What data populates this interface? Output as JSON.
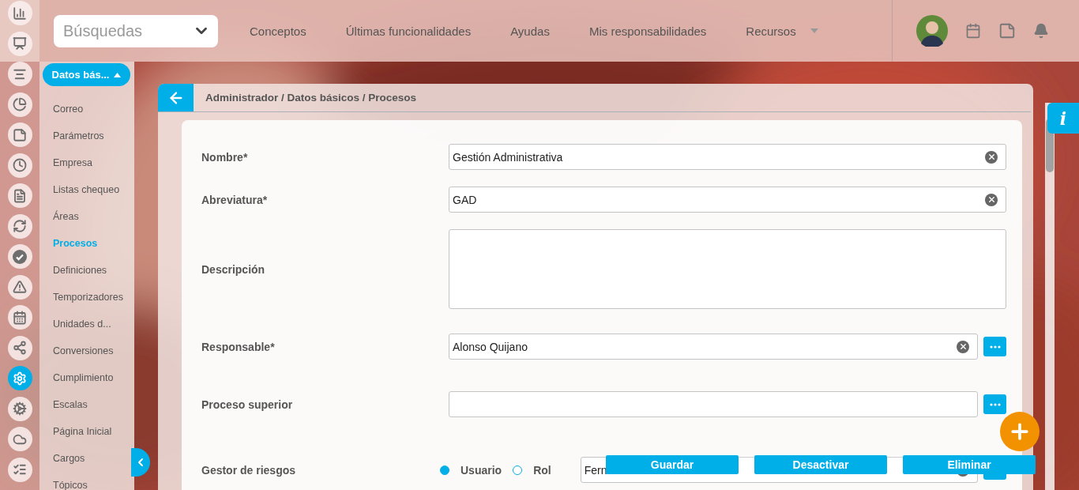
{
  "search": {
    "placeholder": "Búsquedas"
  },
  "nav": [
    {
      "label": "Conceptos"
    },
    {
      "label": "Últimas funcionalidades"
    },
    {
      "label": "Ayudas"
    },
    {
      "label": "Mis responsabilidades"
    },
    {
      "label": "Recursos",
      "dropdown": true
    }
  ],
  "rail": [
    {
      "selected": false
    },
    {
      "selected": false
    },
    {
      "selected": false
    },
    {
      "selected": false
    },
    {
      "selected": false
    },
    {
      "selected": false
    },
    {
      "selected": false
    },
    {
      "selected": false
    },
    {
      "selected": false
    },
    {
      "selected": false
    },
    {
      "selected": false
    },
    {
      "selected": false
    },
    {
      "selected": true
    },
    {
      "selected": false
    },
    {
      "selected": false
    },
    {
      "selected": false
    }
  ],
  "sidebar": {
    "section": "Datos bás...",
    "items": [
      {
        "label": "Correo",
        "selected": false
      },
      {
        "label": "Parámetros",
        "selected": false
      },
      {
        "label": "Empresa",
        "selected": false
      },
      {
        "label": "Listas chequeo",
        "selected": false
      },
      {
        "label": "Áreas",
        "selected": false
      },
      {
        "label": "Procesos",
        "selected": true
      },
      {
        "label": "Definiciones",
        "selected": false
      },
      {
        "label": "Temporizadores",
        "selected": false
      },
      {
        "label": "Unidades d...",
        "selected": false
      },
      {
        "label": "Conversiones",
        "selected": false
      },
      {
        "label": "Cumplimiento",
        "selected": false
      },
      {
        "label": "Escalas",
        "selected": false
      },
      {
        "label": "Página Inicial",
        "selected": false
      },
      {
        "label": "Cargos",
        "selected": false
      },
      {
        "label": "Tópicos",
        "selected": false
      }
    ]
  },
  "breadcrumb": "Administrador / Datos básicos / Procesos",
  "form": [
    {
      "kind": "text",
      "label": "Nombre*",
      "value": "Gestión Administrativa"
    },
    {
      "kind": "text",
      "label": "Abreviatura*",
      "value": "GAD"
    },
    {
      "kind": "textarea",
      "label": "Descripción"
    },
    {
      "kind": "lookup",
      "label": "Responsable*",
      "value": "Alonso Quijano"
    },
    {
      "kind": "lookup",
      "label": "Proceso superior"
    },
    {
      "kind": "radio-lookup",
      "label": "Gestor de riesgos",
      "options": [
        {
          "label": "Usuario",
          "selected": true
        },
        {
          "label": "Rol",
          "selected": false
        }
      ],
      "value": "Fern"
    }
  ],
  "info_button": "i",
  "actions": [
    {
      "label": "Guardar"
    },
    {
      "label": "Desactivar"
    },
    {
      "label": "Eliminar"
    }
  ]
}
